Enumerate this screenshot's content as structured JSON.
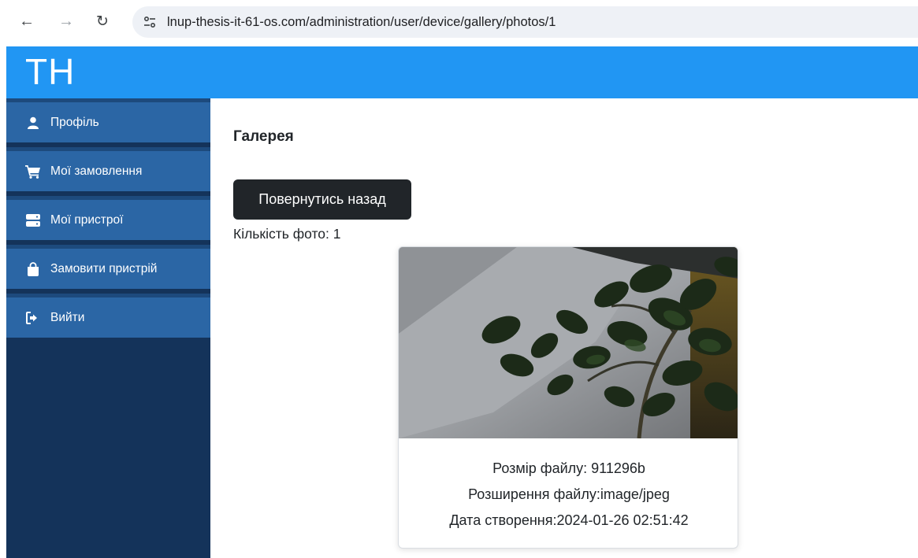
{
  "browser": {
    "url": "lnup-thesis-it-61-os.com/administration/user/device/gallery/photos/1"
  },
  "header": {
    "brand": "TH",
    "color": "#2196f3"
  },
  "sidebar": {
    "items": [
      {
        "label": "Профіль",
        "icon": "user-icon"
      },
      {
        "label": "Мої замовлення",
        "icon": "cart-icon"
      },
      {
        "label": "Мої пристрої",
        "icon": "server-icon"
      },
      {
        "label": "Замовити пристрій",
        "icon": "shopping-bag-icon"
      },
      {
        "label": "Вийти",
        "icon": "logout-icon"
      }
    ]
  },
  "main": {
    "title": "Галерея",
    "back_button": "Повернутись назад",
    "photo_count": "Кількість фото: 1",
    "photo": {
      "file_size": "Розмір файлу: 911296b",
      "extension": "Розширення файлу:image/jpeg",
      "created": "Дата створення:2024-01-26 02:51:42"
    }
  }
}
